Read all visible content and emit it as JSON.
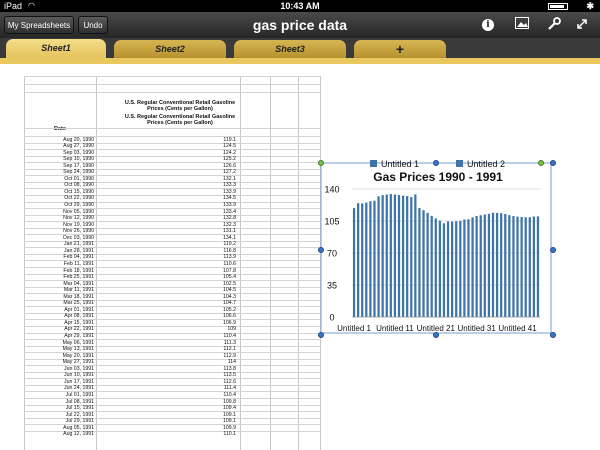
{
  "status": {
    "device": "iPad",
    "time": "10:43 AM",
    "battery_level": 0.85
  },
  "toolbar": {
    "spreadsheets_label": "My Spreadsheets",
    "undo_label": "Undo",
    "title": "gas price data"
  },
  "tabs": [
    {
      "label": "Sheet1",
      "active": true
    },
    {
      "label": "Sheet2"
    },
    {
      "label": "Sheet3"
    },
    {
      "label": "+"
    }
  ],
  "sheet": {
    "header_line1": "U.S. Regular Conventional Retail Gasoline Prices (Cents per Gallon)",
    "header_line2": "U.S. Regular Conventional Retail Gasoline Prices (Cents per Gallon)",
    "date_header": "Date",
    "rows": [
      [
        "Aug 20, 1990",
        "119.1"
      ],
      [
        "Aug 27, 1990",
        "124.5"
      ],
      [
        "Sep 03, 1990",
        "124.2"
      ],
      [
        "Sep 10, 1990",
        "125.2"
      ],
      [
        "Sep 17, 1990",
        "126.6"
      ],
      [
        "Sep 24, 1990",
        "127.2"
      ],
      [
        "Oct 01, 1990",
        "132.1"
      ],
      [
        "Oct 08, 1990",
        "133.3"
      ],
      [
        "Oct 15, 1990",
        "133.9"
      ],
      [
        "Oct 22, 1990",
        "134.5"
      ],
      [
        "Oct 29, 1990",
        "133.9"
      ],
      [
        "Nov 05, 1990",
        "133.4"
      ],
      [
        "Nov 12, 1990",
        "132.8"
      ],
      [
        "Nov 19, 1990",
        "132.3"
      ],
      [
        "Nov 26, 1990",
        "131.1"
      ],
      [
        "Dec 03, 1990",
        "134.1"
      ],
      [
        "Jan 21, 1991",
        "119.2"
      ],
      [
        "Jan 28, 1991",
        "116.8"
      ],
      [
        "Feb 04, 1991",
        "113.9"
      ],
      [
        "Feb 11, 1991",
        "110.6"
      ],
      [
        "Feb 18, 1991",
        "107.8"
      ],
      [
        "Feb 25, 1991",
        "105.4"
      ],
      [
        "Mar 04, 1991",
        "102.5"
      ],
      [
        "Mar 11, 1991",
        "104.5"
      ],
      [
        "Mar 18, 1991",
        "104.3"
      ],
      [
        "Mar 25, 1991",
        "104.7"
      ],
      [
        "Apr 01, 1991",
        "105.2"
      ],
      [
        "Apr 08, 1991",
        "106.6"
      ],
      [
        "Apr 15, 1991",
        "106.9"
      ],
      [
        "Apr 22, 1991",
        "109"
      ],
      [
        "Apr 29, 1991",
        "110.4"
      ],
      [
        "May 06, 1991",
        "111.3"
      ],
      [
        "May 13, 1991",
        "112.1"
      ],
      [
        "May 20, 1991",
        "112.9"
      ],
      [
        "May 27, 1991",
        "114"
      ],
      [
        "Jun 03, 1991",
        "113.8"
      ],
      [
        "Jun 10, 1991",
        "113.5"
      ],
      [
        "Jun 17, 1991",
        "112.6"
      ],
      [
        "Jun 24, 1991",
        "111.4"
      ],
      [
        "Jul 01, 1991",
        "110.4"
      ],
      [
        "Jul 08, 1991",
        "109.8"
      ],
      [
        "Jul 15, 1991",
        "109.4"
      ],
      [
        "Jul 22, 1991",
        "109.1"
      ],
      [
        "Jul 29, 1991",
        "109.1"
      ],
      [
        "Aug 05, 1991",
        "109.9"
      ],
      [
        "Aug 12, 1991",
        "110.1"
      ]
    ]
  },
  "chart_data": {
    "type": "bar",
    "title": "Gas Prices 1990 - 1991",
    "legend": [
      "Untitled 1",
      "Untitled 2"
    ],
    "legend_position": "top",
    "series_color": "#3f74a8",
    "ylim": [
      0,
      140
    ],
    "yticks": [
      "0",
      "35",
      "70",
      "105",
      "140"
    ],
    "xticks": [
      "Untitled 1",
      "Untitled 11",
      "Untitled 21",
      "Untitled 31",
      "Untitled 41"
    ],
    "grid": true,
    "values": [
      119.1,
      124.5,
      124.2,
      125.2,
      126.6,
      127.2,
      132.1,
      133.3,
      133.9,
      134.5,
      133.9,
      133.4,
      132.8,
      132.3,
      131.1,
      134.1,
      119.2,
      116.8,
      113.9,
      110.6,
      107.8,
      105.4,
      102.5,
      104.5,
      104.3,
      104.7,
      105.2,
      106.6,
      106.9,
      109,
      110.4,
      111.3,
      112.1,
      112.9,
      114,
      113.8,
      113.5,
      112.6,
      111.4,
      110.4,
      109.8,
      109.4,
      109.1,
      109.1,
      109.9,
      110.1
    ]
  }
}
